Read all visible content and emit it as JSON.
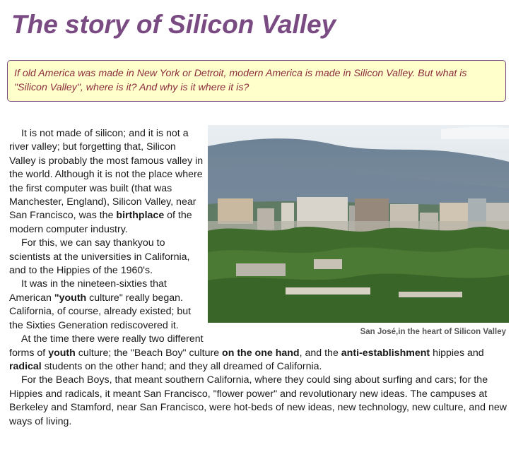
{
  "page": {
    "title": "The story of Silicon Valley"
  },
  "intro": {
    "text": "If old America was made in New York or Detroit, modern America is made in Silicon Valley. But what is \"Silicon Valley\", where is it? And why is it where it is?"
  },
  "figure": {
    "caption": "San José,in the heart of Silicon Valley"
  },
  "article": {
    "p1_a": "It is not made of silicon; and it is not a river valley; but forgetting that, Silicon Valley is probably the most famous valley in the world. Although it is not the place where the first computer was built (that was Manchester, England), Silicon Valley, near San Francisco,  was the ",
    "p1_bold": "birthplace",
    "p1_b": " of the modern computer industry.",
    "p2": "For this, we can say thankyou to scientists at the universities in California, and to the Hippies of the 1960's.",
    "p3_a": "It was in the nineteen-sixties that American ",
    "p3_bold": "\"youth",
    "p3_b": " culture\" really began. California, of course, already existed; but the Sixties Generation rediscovered it.",
    "p4_a": "At the time there were really two different forms of ",
    "p4_bold1": "youth",
    "p4_b": " culture; the \"Beach Boy\" culture ",
    "p4_bold2": "on the one hand",
    "p4_c": ", and the ",
    "p4_bold3": "anti-establishment",
    "p4_d": " hippies and ",
    "p4_bold4": "radical",
    "p4_e": " students on the other hand; and they all dreamed of California.",
    "p5": "For the Beach Boys, that meant southern California, where they could sing about surfing and cars; for the Hippies and radicals, it meant San Francisco, \"flower power\" and revolutionary new ideas. The campuses at Berkeley and Stamford, near San Francisco, were hot-beds of new ideas, new technology, new culture, and new ways of living."
  }
}
